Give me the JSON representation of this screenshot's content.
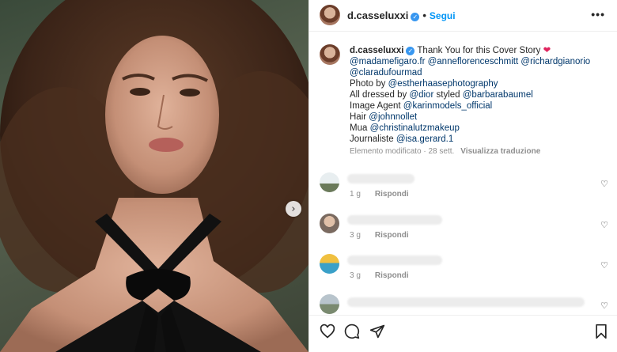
{
  "post": {
    "username": "d.casseluxxi",
    "verified_mark": "✓",
    "separator": "•",
    "follow_label": "Segui",
    "more_label": "•••",
    "carousel_next": "›"
  },
  "caption": {
    "username": "d.casseluxxi",
    "intro": "Thank You for this Cover Story",
    "heart": "❤",
    "mentions_line1": [
      "@madamefigaro.fr",
      "@anneflorenceschmitt",
      "@richardgianorio"
    ],
    "mentions_line2": "@claradufourmad",
    "photo_prefix": "Photo by",
    "photo_mention": "@estherhaasephotography",
    "dressed_prefix": "All dressed by",
    "dressed_mention1": "@dior",
    "styled_word": "styled",
    "dressed_mention2": "@barbarabaumel",
    "agent_prefix": "Image Agent",
    "agent_mention": "@karinmodels_official",
    "hair_prefix": "Hair",
    "hair_mention": "@johnnollet",
    "mua_prefix": "Mua",
    "mua_mention": "@christinalutzmakeup",
    "journ_prefix": "Journaliste",
    "journ_mention": "@isa.gerard.1",
    "meta": "Elemento modificato · 28 sett.",
    "translate": "Visualizza traduzione"
  },
  "comments": [
    {
      "time": "1 g",
      "reply": "Rispondi",
      "heart": "♡"
    },
    {
      "time": "3 g",
      "reply": "Rispondi",
      "heart": "♡"
    },
    {
      "time": "3 g",
      "reply": "Rispondi",
      "heart": "♡"
    },
    {
      "heart": "♡"
    }
  ],
  "colors": {
    "link": "#00376b",
    "follow": "#0095f6",
    "verified": "#3897f0"
  }
}
